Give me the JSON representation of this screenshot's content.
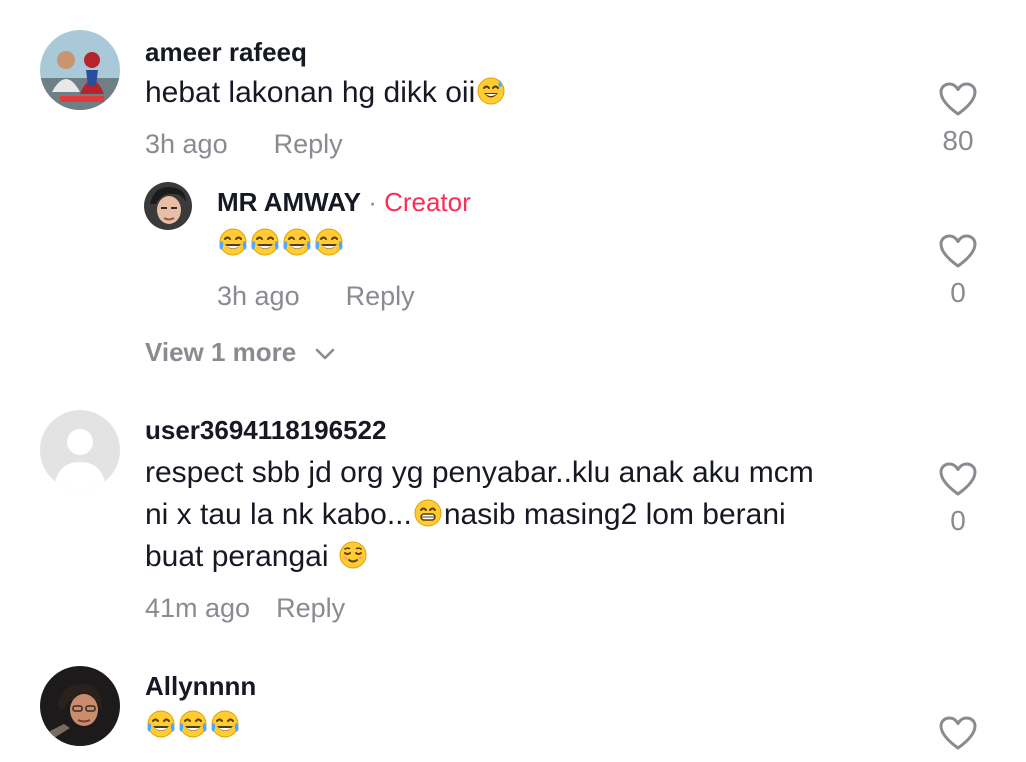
{
  "comments": [
    {
      "username": "ameer rafeeq",
      "text_before": "hebat lakonan hg dikk oii",
      "time": "3h ago",
      "reply_label": "Reply",
      "likes": "80",
      "replies": [
        {
          "username": "MR AMWAY",
          "separator": " · ",
          "badge": "Creator",
          "time": "3h ago",
          "reply_label": "Reply",
          "likes": "0"
        }
      ],
      "view_more": "View 1 more"
    },
    {
      "username": "user3694118196522",
      "line1": "respect sbb jd org yg penyabar..klu anak aku mcm",
      "line2a": "ni x tau la nk kabo...",
      "line2b": "nasib masing2 lom berani",
      "line3": "buat perangai ",
      "time": "41m ago",
      "reply_label": "Reply",
      "likes": "0"
    },
    {
      "username": "Allynnnn"
    }
  ],
  "icons": {
    "heart": "heart-outline-icon",
    "chevron": "chevron-down-icon",
    "emoji_sweat": "grinning-sweat-emoji",
    "emoji_tears": "tears-of-joy-emoji",
    "emoji_grin": "grinning-emoji",
    "emoji_relieved": "relieved-emoji"
  },
  "colors": {
    "creator": "#fe2c55",
    "muted": "#8a8b91",
    "text": "#161823"
  }
}
